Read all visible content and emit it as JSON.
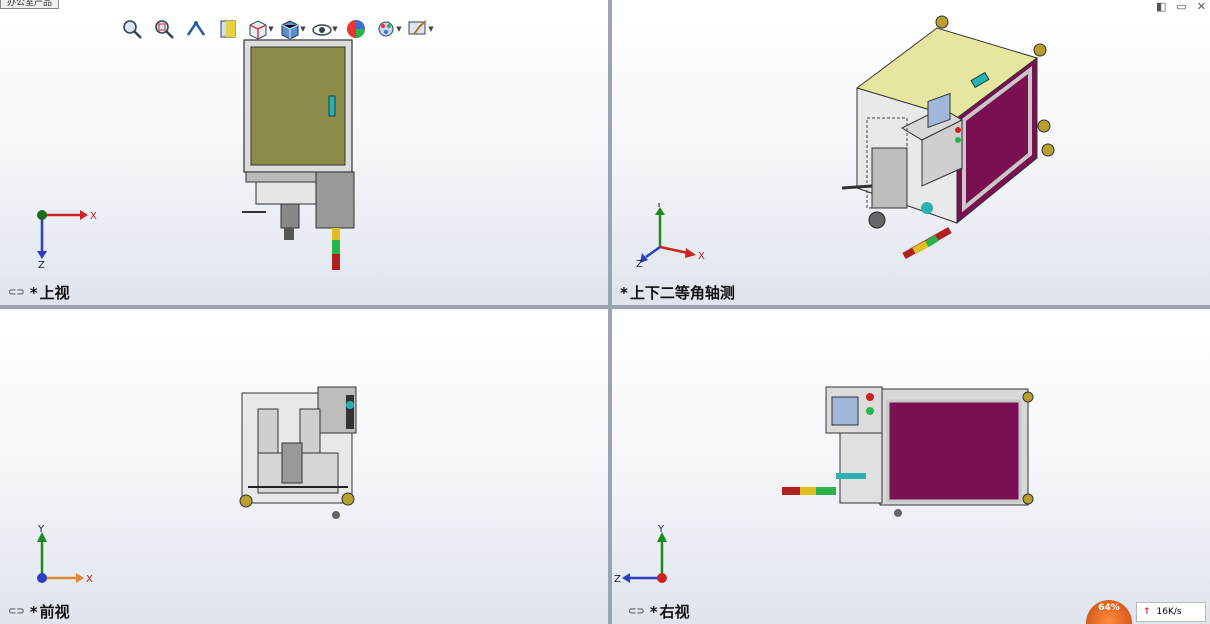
{
  "menu": {
    "label": "办公室产品"
  },
  "window_controls": [
    "◧",
    "▭",
    "✕"
  ],
  "toolbar": {
    "buttons": [
      {
        "name": "zoom-to-fit-icon"
      },
      {
        "name": "zoom-to-area-icon"
      },
      {
        "name": "previous-view-icon"
      },
      {
        "name": "section-view-icon"
      },
      {
        "name": "view-orientation-icon"
      },
      {
        "name": "display-style-icon"
      },
      {
        "name": "hide-show-items-icon"
      },
      {
        "name": "edit-appearance-icon"
      },
      {
        "name": "apply-scene-icon"
      },
      {
        "name": "view-settings-icon"
      }
    ]
  },
  "viewports": [
    {
      "id": "top",
      "label": "上视",
      "prefix": "*",
      "axes": [
        "X",
        "Z"
      ]
    },
    {
      "id": "iso",
      "label": "上下二等角轴测",
      "prefix": "*",
      "axes": [
        "X",
        "Y",
        "Z"
      ]
    },
    {
      "id": "front",
      "label": "前视",
      "prefix": "*",
      "axes": [
        "X",
        "Y"
      ]
    },
    {
      "id": "right",
      "label": "右视",
      "prefix": "*",
      "axes": [
        "Y",
        "Z"
      ]
    }
  ],
  "status": {
    "percent": "64%",
    "speed": "16K/s"
  },
  "colors": {
    "panel_olive": "#8c8c4a",
    "panel_yellow": "#e6e69a",
    "panel_magenta": "#7a0f52",
    "frame_gray": "#c8c8c8",
    "accent_cyan": "#2ab0b0"
  }
}
